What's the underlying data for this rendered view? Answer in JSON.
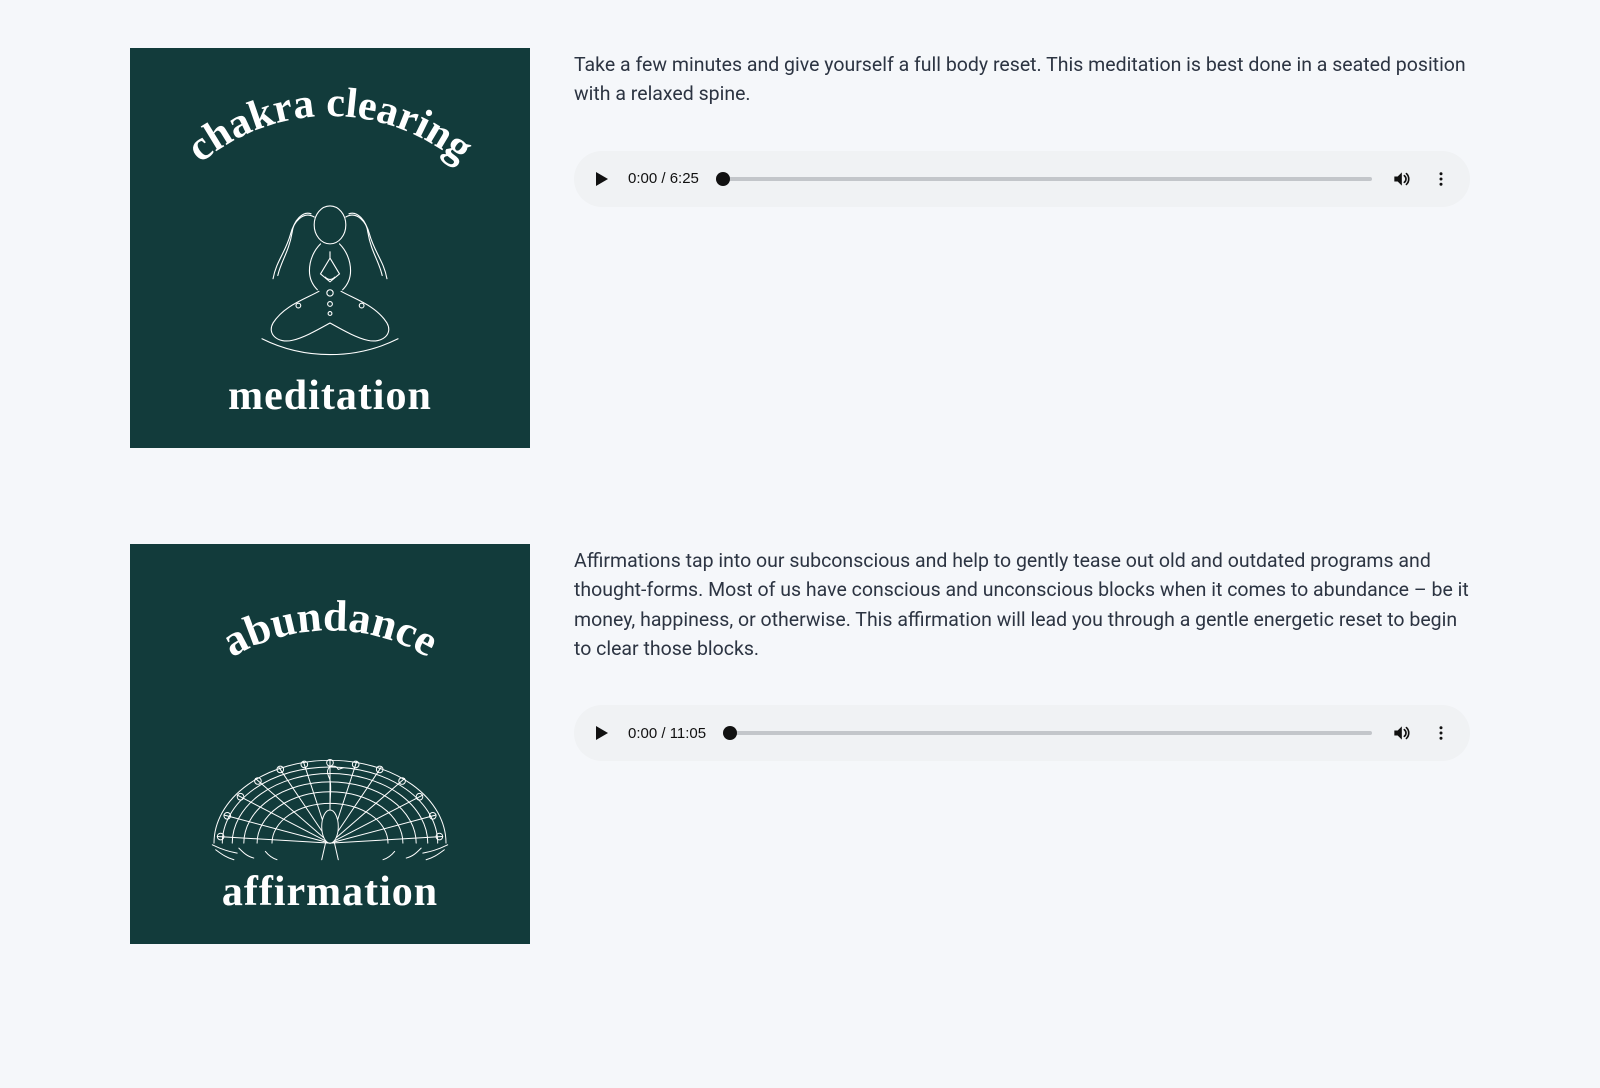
{
  "items": [
    {
      "tile_top": "chakra clearing",
      "tile_bottom": "meditation",
      "description": "Take a few minutes and give yourself a full body reset. This meditation is best done in a seated position with a relaxed spine.",
      "player": {
        "time": "0:00 / 6:25"
      }
    },
    {
      "tile_top": "abundance",
      "tile_bottom": "affirmation",
      "description": "Affirmations tap into our subconscious and help to gently tease out old and outdated programs and thought-forms. Most of us have conscious and unconscious blocks when it comes to abundance – be it money, happiness, or otherwise. This affirmation will lead you through a gentle energetic reset to begin to clear those blocks.",
      "player": {
        "time": "0:00 / 11:05"
      }
    }
  ]
}
